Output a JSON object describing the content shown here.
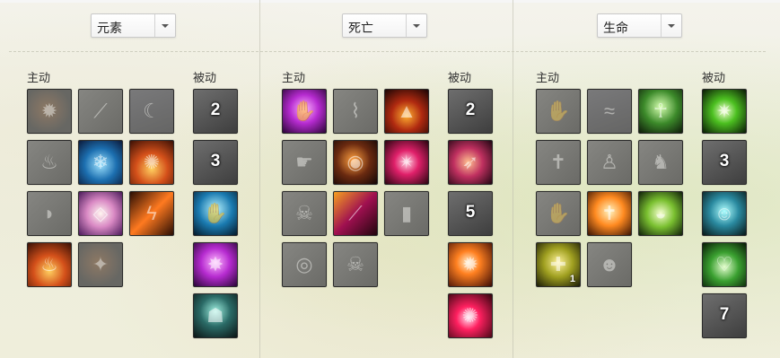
{
  "panels": [
    {
      "dropdown": "元素",
      "active_label": "主动",
      "passive_label": "被动",
      "active": [
        {
          "icon": "fire-orb-icon",
          "theme": "g1",
          "dim": true
        },
        {
          "icon": "claw-strike-icon",
          "theme": "g2",
          "dim": true
        },
        {
          "icon": "shadow-wisp-icon",
          "theme": "g3",
          "dim": true
        },
        {
          "icon": "flame-figure-icon",
          "theme": "g2",
          "dim": true
        },
        {
          "icon": "ice-foot-icon",
          "theme": "gblue",
          "dim": false
        },
        {
          "icon": "fire-burst-icon",
          "theme": "gfire",
          "dim": false
        },
        {
          "icon": "stone-step-icon",
          "theme": "g2",
          "dim": true
        },
        {
          "icon": "paper-icon",
          "theme": "gpaper",
          "dim": false
        },
        {
          "icon": "lightning-icon",
          "theme": "gbolt",
          "dim": false
        },
        {
          "icon": "inferno-icon",
          "theme": "gfire",
          "dim": false
        },
        {
          "icon": "ember-icon",
          "theme": "g1",
          "dim": true
        }
      ],
      "passive": [
        {
          "icon": "locked-passive-icon",
          "theme": "shade",
          "dim": false,
          "level": "2"
        },
        {
          "icon": "locked-passive-icon",
          "theme": "shade",
          "dim": false,
          "level": "3"
        },
        {
          "icon": "frost-hand-icon",
          "theme": "gcyan",
          "dim": false
        },
        {
          "icon": "energy-hands-icon",
          "theme": "gpurple",
          "dim": false
        },
        {
          "icon": "hooded-mage-icon",
          "theme": "ghood",
          "dim": false
        }
      ]
    },
    {
      "dropdown": "死亡",
      "active_label": "主动",
      "passive_label": "被动",
      "active": [
        {
          "icon": "purple-hand-icon",
          "theme": "gpurple",
          "dim": false
        },
        {
          "icon": "wing-icon",
          "theme": "g2",
          "dim": true
        },
        {
          "icon": "dark-spire-icon",
          "theme": "gspire",
          "dim": false
        },
        {
          "icon": "grasp-icon",
          "theme": "g2",
          "dim": true
        },
        {
          "icon": "raven-icon",
          "theme": "graven",
          "dim": false
        },
        {
          "icon": "red-star-icon",
          "theme": "gred",
          "dim": false
        },
        {
          "icon": "skull-icon",
          "theme": "g2",
          "dim": true
        },
        {
          "icon": "claw-slash-icon",
          "theme": "gclaw",
          "dim": false
        },
        {
          "icon": "grave-icon",
          "theme": "g2",
          "dim": true
        },
        {
          "icon": "cracked-orb-icon",
          "theme": "g2",
          "dim": true
        },
        {
          "icon": "skull-burst-icon",
          "theme": "g2",
          "dim": true
        }
      ],
      "passive": [
        {
          "icon": "locked-passive-icon",
          "theme": "shade",
          "dim": false,
          "level": "2"
        },
        {
          "icon": "beak-icon",
          "theme": "gbeak",
          "dim": false
        },
        {
          "icon": "locked-passive-icon",
          "theme": "shade",
          "dim": false,
          "level": "5"
        },
        {
          "icon": "explosion-icon",
          "theme": "gburst",
          "dim": false
        },
        {
          "icon": "blood-pop-icon",
          "theme": "gpop",
          "dim": false
        }
      ]
    },
    {
      "dropdown": "生命",
      "active_label": "主动",
      "passive_label": "被动",
      "active": [
        {
          "icon": "raised-hand-icon",
          "theme": "g2",
          "dim": true
        },
        {
          "icon": "mist-icon",
          "theme": "g3",
          "dim": true
        },
        {
          "icon": "angel-icon",
          "theme": "gangel",
          "dim": false
        },
        {
          "icon": "tombstone-cross-icon",
          "theme": "g2",
          "dim": true
        },
        {
          "icon": "figure-icon",
          "theme": "g2",
          "dim": true
        },
        {
          "icon": "dancing-figures-icon",
          "theme": "g2",
          "dim": true
        },
        {
          "icon": "reaching-hands-icon",
          "theme": "g2",
          "dim": true
        },
        {
          "icon": "resurrection-icon",
          "theme": "gcross",
          "dim": false
        },
        {
          "icon": "seed-icon",
          "theme": "gseed",
          "dim": false
        },
        {
          "icon": "heal-plus-icon",
          "theme": "gheal",
          "dim": false,
          "small": "1"
        },
        {
          "icon": "group-icon",
          "theme": "g2",
          "dim": true
        }
      ],
      "passive": [
        {
          "icon": "green-glow-icon",
          "theme": "ggreen",
          "dim": false
        },
        {
          "icon": "locked-passive-icon",
          "theme": "shade",
          "dim": false,
          "level": "3"
        },
        {
          "icon": "glowing-face-icon",
          "theme": "gface",
          "dim": false
        },
        {
          "icon": "heart-hands-icon",
          "theme": "gheart",
          "dim": false
        },
        {
          "icon": "locked-passive-icon",
          "theme": "shade",
          "dim": false,
          "level": "7"
        }
      ]
    }
  ]
}
